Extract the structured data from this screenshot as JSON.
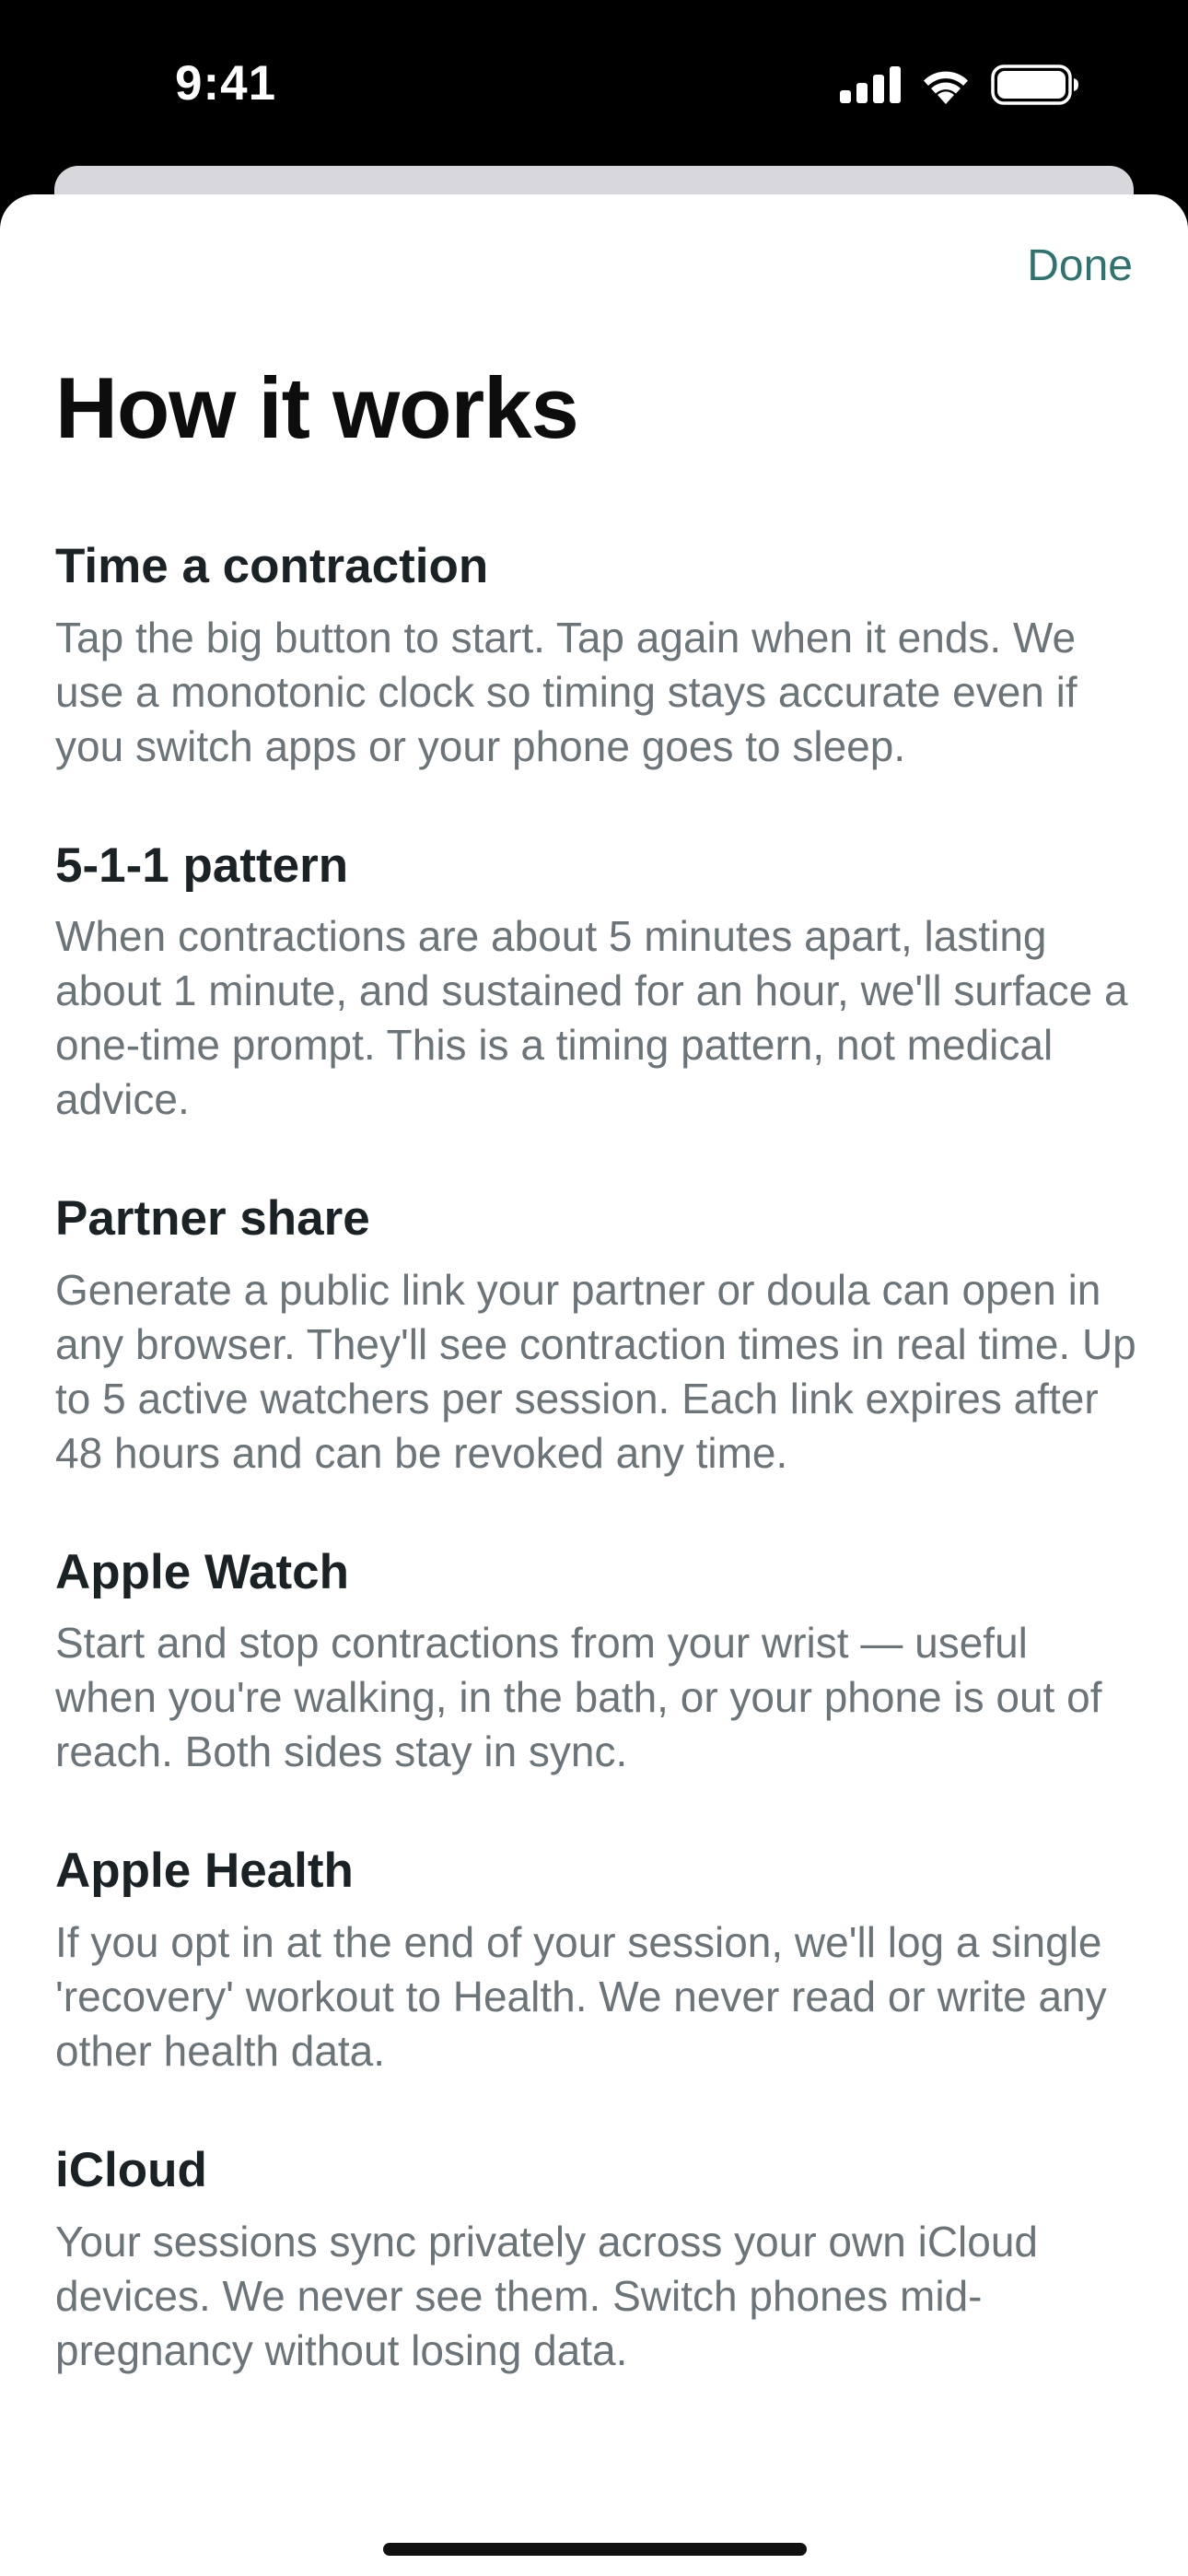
{
  "status_bar": {
    "time": "9:41"
  },
  "header": {
    "done_label": "Done",
    "title": "How it works"
  },
  "sections": [
    {
      "heading": "Time a contraction",
      "body": "Tap the big button to start. Tap again when it ends. We use a monotonic clock so timing stays accurate even if you switch apps or your phone goes to sleep."
    },
    {
      "heading": "5-1-1 pattern",
      "body": "When contractions are about 5 minutes apart, lasting about 1 minute, and sustained for an hour, we'll surface a one-time prompt. This is a timing pattern, not medical advice."
    },
    {
      "heading": "Partner share",
      "body": "Generate a public link your partner or doula can open in any browser. They'll see contraction times in real time. Up to 5 active watchers per session. Each link expires after 48 hours and can be revoked any time."
    },
    {
      "heading": "Apple Watch",
      "body": "Start and stop contractions from your wrist — useful when you're walking, in the bath, or your phone is out of reach. Both sides stay in sync."
    },
    {
      "heading": "Apple Health",
      "body": "If you opt in at the end of your session, we'll log a single 'recovery' workout to Health. We never read or write any other health data."
    },
    {
      "heading": "iCloud",
      "body": "Your sessions sync privately across your own iCloud devices. We never see them. Switch phones mid-pregnancy without losing data."
    }
  ],
  "colors": {
    "accent": "#2f7370",
    "heading": "#1a2226",
    "body_text": "#6b7479"
  },
  "icons": {
    "signal": "cellular-signal-icon",
    "wifi": "wifi-icon",
    "battery": "battery-icon"
  }
}
